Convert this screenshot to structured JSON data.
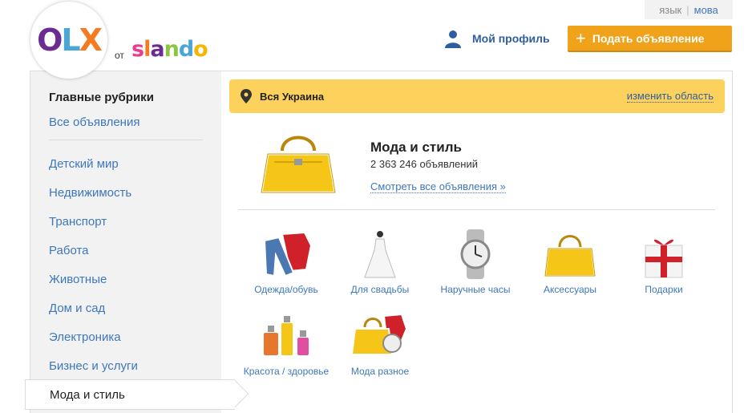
{
  "lang": {
    "ru": "язык",
    "ua": "мова"
  },
  "logo": {
    "brand": "OLX",
    "connector": "от",
    "partner": "slando"
  },
  "header": {
    "profile": "Мой профиль",
    "post_ad": "Подать объявление"
  },
  "sidebar": {
    "title": "Главные рубрики",
    "all": "Все объявления",
    "items": [
      "Детский мир",
      "Недвижимость",
      "Транспорт",
      "Работа",
      "Животные",
      "Дом и сад",
      "Электроника",
      "Бизнес и услуги"
    ],
    "active": "Мода и стиль"
  },
  "region": {
    "name": "Вся Украина",
    "change": "изменить область"
  },
  "category": {
    "title": "Мода и стиль",
    "count": "2 363 246 объявлений",
    "view_all": "Смотреть все объявления »"
  },
  "subcategories": [
    {
      "label": "Одежда/обувь",
      "icon": "clothes-icon"
    },
    {
      "label": "Для свадьбы",
      "icon": "wedding-dress-icon"
    },
    {
      "label": "Наручные часы",
      "icon": "wristwatch-icon"
    },
    {
      "label": "Аксессуары",
      "icon": "handbag-icon"
    },
    {
      "label": "Подарки",
      "icon": "gift-icon"
    },
    {
      "label": "Красота / здоровье",
      "icon": "perfume-icon"
    },
    {
      "label": "Мода разное",
      "icon": "fashion-mix-icon"
    }
  ],
  "colors": {
    "accent": "#f0a21a",
    "link": "#3e77bd",
    "region_bg": "#fdd25c",
    "sidebar_bg": "#f2f2f2"
  }
}
